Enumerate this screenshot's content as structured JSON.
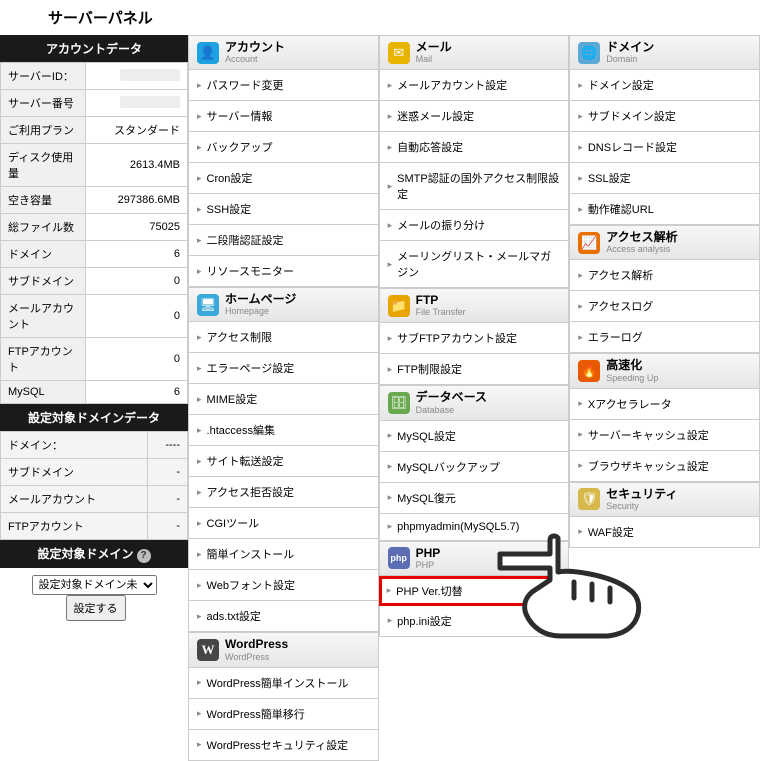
{
  "title": "サーバーパネル",
  "account_hdr": "アカウントデータ",
  "acct": [
    {
      "k": "サーバーID：",
      "v": ""
    },
    {
      "k": "サーバー番号",
      "v": ""
    },
    {
      "k": "ご利用プラン",
      "v": "スタンダード"
    },
    {
      "k": "ディスク使用量",
      "v": "2613.4MB"
    },
    {
      "k": "空き容量",
      "v": "297386.6MB"
    },
    {
      "k": "総ファイル数",
      "v": "75025"
    },
    {
      "k": "ドメイン",
      "v": "6"
    },
    {
      "k": "サブドメイン",
      "v": "0"
    },
    {
      "k": "メールアカウント",
      "v": "0"
    },
    {
      "k": "FTPアカウント",
      "v": "0"
    },
    {
      "k": "MySQL",
      "v": "6"
    }
  ],
  "tgt_hdr": "設定対象ドメインデータ",
  "tgt": [
    {
      "k": "ドメイン：",
      "v": "----"
    },
    {
      "k": "サブドメイン",
      "v": "-"
    },
    {
      "k": "メールアカウント",
      "v": "-"
    },
    {
      "k": "FTPアカウント",
      "v": "-"
    }
  ],
  "sel_hdr": "設定対象ドメイン",
  "sel_opt": "設定対象ドメイン未",
  "sel_btn": "設定する",
  "cats": {
    "account": {
      "t": "アカウント",
      "s": "Account",
      "ico": "👤",
      "c": "#1da1e0",
      "items": [
        "パスワード変更",
        "サーバー情報",
        "バックアップ",
        "Cron設定",
        "SSH設定",
        "二段階認証設定",
        "リソースモニター"
      ]
    },
    "mail": {
      "t": "メール",
      "s": "Mail",
      "ico": "✉",
      "c": "#e8b400",
      "items": [
        "メールアカウント設定",
        "迷惑メール設定",
        "自動応答設定",
        "SMTP認証の国外アクセス制限設定",
        "メールの振り分け",
        "メーリングリスト・メールマガジン"
      ]
    },
    "domain": {
      "t": "ドメイン",
      "s": "Domain",
      "ico": "🌐",
      "c": "#5aa9d6",
      "items": [
        "ドメイン設定",
        "サブドメイン設定",
        "DNSレコード設定",
        "SSL設定",
        "動作確認URL"
      ]
    },
    "homepage": {
      "t": "ホームページ",
      "s": "Homepage",
      "ico": "🖥",
      "c": "#3aa8d8",
      "items": [
        "アクセス制限",
        "エラーページ設定",
        "MIME設定",
        ".htaccess編集",
        "サイト転送設定",
        "アクセス拒否設定",
        "CGIツール",
        "簡単インストール",
        "Webフォント設定",
        "ads.txt設定"
      ]
    },
    "ftp": {
      "t": "FTP",
      "s": "File Transfer",
      "ico": "📁",
      "c": "#e8a400",
      "items": [
        "サブFTPアカウント設定",
        "FTP制限設定"
      ]
    },
    "access": {
      "t": "アクセス解析",
      "s": "Access analysis",
      "ico": "📈",
      "c": "#e87000",
      "items": [
        "アクセス解析",
        "アクセスログ",
        "エラーログ"
      ]
    },
    "database": {
      "t": "データベース",
      "s": "Database",
      "ico": "🗄",
      "c": "#6aa84f",
      "items": [
        "MySQL設定",
        "MySQLバックアップ",
        "MySQL復元",
        "phpmyadmin(MySQL5.7)"
      ]
    },
    "speed": {
      "t": "高速化",
      "s": "Speeding Up",
      "ico": "🔥",
      "c": "#e85a00",
      "items": [
        "Xアクセラレータ",
        "サーバーキャッシュ設定",
        "ブラウザキャッシュ設定"
      ]
    },
    "wordpress": {
      "t": "WordPress",
      "s": "WordPress",
      "ico": "Ⓦ",
      "c": "#555",
      "items": [
        "WordPress簡単インストール",
        "WordPress簡単移行",
        "WordPressセキュリティ設定"
      ]
    },
    "php": {
      "t": "PHP",
      "s": "PHP",
      "ico": "php",
      "c": "#5a6db5",
      "items": [
        "PHP Ver.切替",
        "php.ini設定"
      ]
    },
    "security": {
      "t": "セキュリティ",
      "s": "Security",
      "ico": "🛡",
      "c": "#d6b94a",
      "items": [
        "WAF設定"
      ]
    }
  },
  "highlighted": "PHP Ver.切替"
}
